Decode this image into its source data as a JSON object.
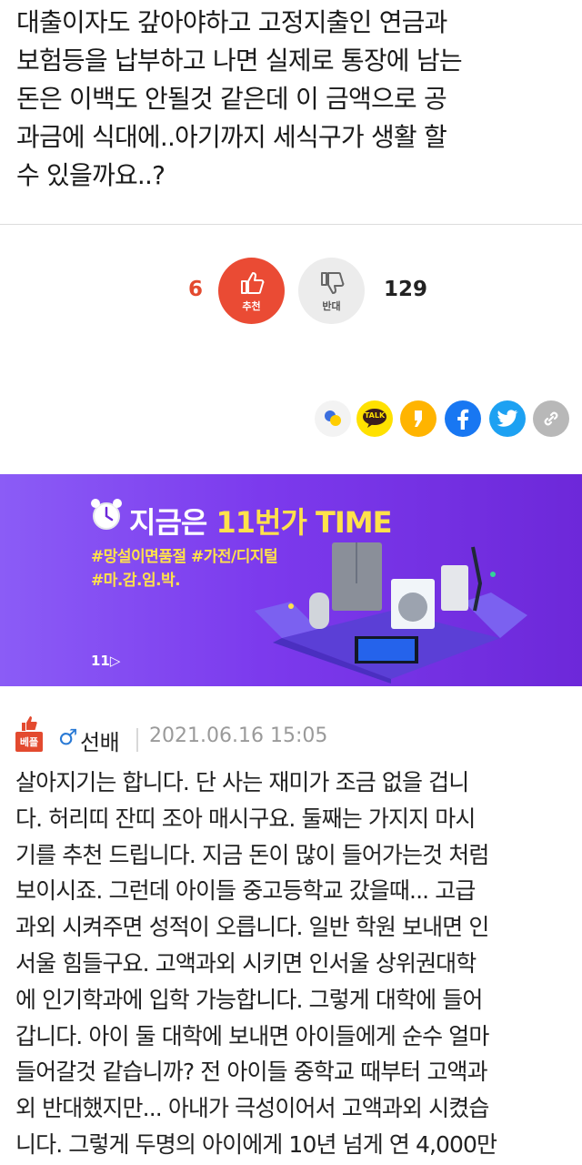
{
  "post": {
    "text": "대출이자도 갚아야하고 고정지출인 연금과\n보험등을 납부하고 나면 실제로 통장에 남는\n돈은 이백도 안될것 같은데 이 금액으로 공\n과금에 식대에..아기까지 세식구가 생활 할\n수 있을까요..?"
  },
  "votes": {
    "up_count": "6",
    "up_label": "추천",
    "down_label": "반대",
    "down_count": "129",
    "up_color": "#ea4b34"
  },
  "share": {
    "icons": [
      "kakaostory-icon",
      "kakaotalk-icon",
      "kakao-story-icon",
      "facebook-icon",
      "twitter-icon",
      "link-icon"
    ],
    "talk_label": "TALK"
  },
  "ad": {
    "title_prefix": "지금은 ",
    "title_highlight": "11번가 TIME",
    "line1": "#망설이면품절 #가전/디지털",
    "line2": "#마.감.임.박.",
    "brand": "11▷",
    "bg_color": "#7c3aed"
  },
  "comment": {
    "badge": "베플",
    "gender": "♂",
    "author": "선배",
    "date": "2021.06.16 15:05",
    "text": "살아지기는 합니다. 단 사는 재미가 조금 없을 겁니\n다. 허리띠 잔띠 조아 매시구요. 둘째는 가지지 마시\n기를 추천 드립니다. 지금 돈이 많이 들어가는것 처럼\n보이시죠. 그런데 아이들 중고등학교 갔을때... 고급\n과외 시켜주면 성적이 오릅니다. 일반 학원 보내면 인\n서울 힘들구요. 고액과외 시키면 인서울 상위권대학\n에 인기학과에 입학 가능합니다. 그렇게 대학에 들어\n갑니다. 아이 둘 대학에 보내면 아이들에게 순수 얼마\n들어갈것 같습니까? 전 아이들 중학교 때부터 고액과\n외 반대했지만... 아내가 극성이어서 고액과외 시켰습\n니다. 그렇게 두명의 아이에게 10년 넘게 연 4,000만"
  }
}
